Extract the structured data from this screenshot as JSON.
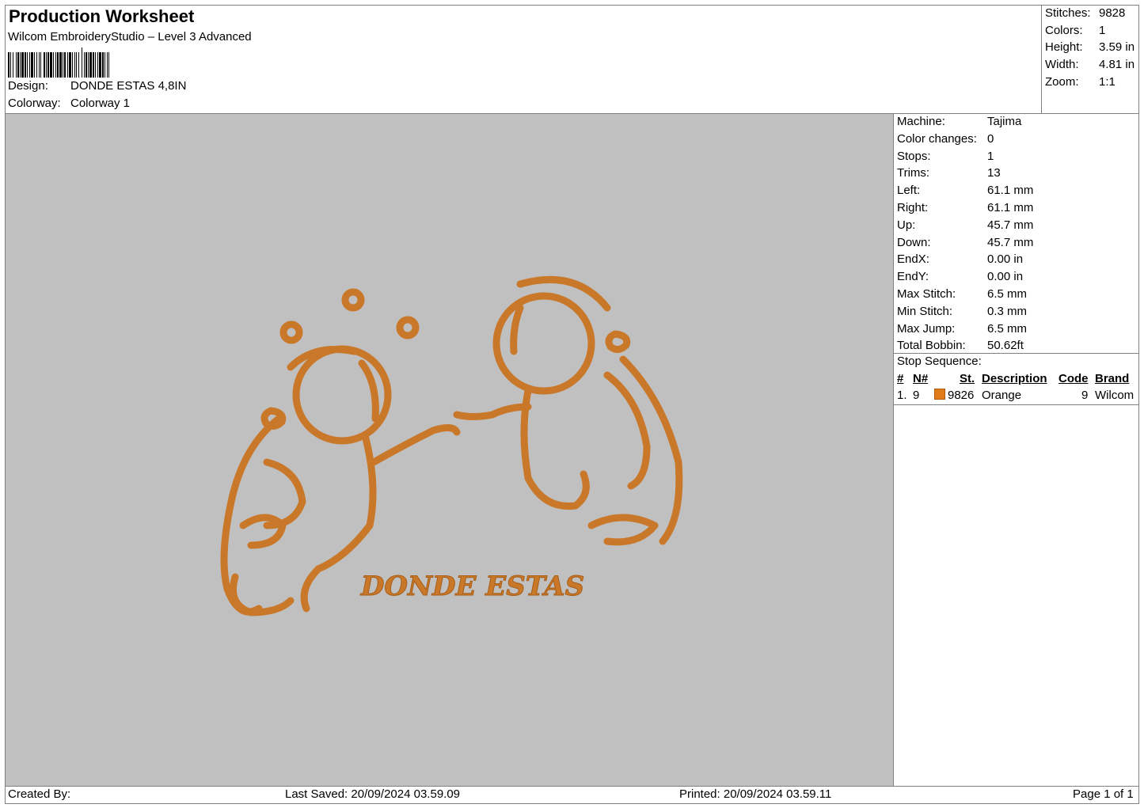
{
  "header": {
    "title": "Production Worksheet",
    "subtitle": "Wilcom EmbroideryStudio – Level 3 Advanced",
    "design_label": "Design:",
    "design_value": "DONDE ESTAS 4,8IN",
    "colorway_label": "Colorway:",
    "colorway_value": "Colorway 1"
  },
  "summary": {
    "stitches_label": "Stitches:",
    "stitches": "9828",
    "colors_label": "Colors:",
    "colors": "1",
    "height_label": "Height:",
    "height": "3.59 in",
    "width_label": "Width:",
    "width": "4.81 in",
    "zoom_label": "Zoom:",
    "zoom": "1:1"
  },
  "machine_info": [
    {
      "label": "Machine:",
      "value": "Tajima"
    },
    {
      "label": "Color changes:",
      "value": "0"
    },
    {
      "label": "Stops:",
      "value": "1"
    },
    {
      "label": "Trims:",
      "value": "13"
    },
    {
      "label": "Left:",
      "value": "61.1 mm"
    },
    {
      "label": "Right:",
      "value": "61.1 mm"
    },
    {
      "label": "Up:",
      "value": "45.7 mm"
    },
    {
      "label": "Down:",
      "value": "45.7 mm"
    },
    {
      "label": "EndX:",
      "value": "0.00 in"
    },
    {
      "label": "EndY:",
      "value": "0.00 in"
    },
    {
      "label": "Max Stitch:",
      "value": "6.5 mm"
    },
    {
      "label": "Min Stitch:",
      "value": "0.3 mm"
    },
    {
      "label": "Max Jump:",
      "value": "6.5 mm"
    },
    {
      "label": "Total Bobbin:",
      "value": "50.62ft"
    }
  ],
  "stop_sequence": {
    "title": "Stop Sequence:",
    "columns": {
      "num": "#",
      "needle": "N#",
      "st": "St.",
      "description": "Description",
      "code": "Code",
      "brand": "Brand"
    },
    "rows": [
      {
        "num": "1.",
        "needle": "9",
        "swatch_color": "#e07b1a",
        "st": "9826",
        "description": "Orange",
        "code": "9",
        "brand": "Wilcom"
      }
    ]
  },
  "design": {
    "text": "DONDE ESTAS",
    "thread_color": "#d98a2f"
  },
  "footer": {
    "created_by": "Created By:",
    "last_saved": "Last Saved: 20/09/2024 03.59.09",
    "printed": "Printed: 20/09/2024 03.59.11",
    "page": "Page 1 of 1"
  }
}
